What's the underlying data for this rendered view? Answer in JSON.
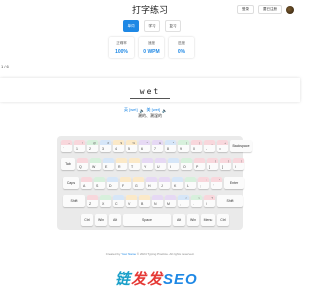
{
  "header": {
    "title": "打字练习",
    "login_label": "登录",
    "register_label": "要已注册"
  },
  "modes": [
    "单词",
    "学习",
    "复习"
  ],
  "stats": [
    {
      "label": "正确率",
      "value": "100%"
    },
    {
      "label": "速度",
      "value": "0 WPM"
    },
    {
      "label": "进度",
      "value": "0%"
    }
  ],
  "progress": "1 / 6",
  "word": "wet",
  "phonetics": {
    "uk": "英 [wet]",
    "us": "美 [wet]",
    "speaker": "🔈"
  },
  "meaning": "潮的、潮湿的",
  "finger_colors": {
    "pinky": "#f8d7dc",
    "ring": "#d7f0dc",
    "middle": "#d6e6f8",
    "index_left": "#fbe9c8",
    "index_right": "#e6d9f4",
    "thumb": "#ffffff"
  },
  "keyboard": {
    "rows": [
      [
        {
          "main": "`",
          "sym": "~"
        },
        {
          "main": "1",
          "sym": "!"
        },
        {
          "main": "2",
          "sym": "@"
        },
        {
          "main": "3",
          "sym": "#"
        },
        {
          "main": "4",
          "sym": "$"
        },
        {
          "main": "5",
          "sym": "%"
        },
        {
          "main": "6",
          "sym": "^"
        },
        {
          "main": "7",
          "sym": "&"
        },
        {
          "main": "8",
          "sym": "*"
        },
        {
          "main": "9",
          "sym": "("
        },
        {
          "main": "0",
          "sym": ")"
        },
        {
          "main": "-",
          "sym": "_"
        },
        {
          "main": "=",
          "sym": "+"
        },
        {
          "main": "Backspace",
          "sym": ""
        }
      ],
      [
        {
          "main": "Tab",
          "sym": ""
        },
        {
          "main": "Q",
          "sym": ""
        },
        {
          "main": "W",
          "sym": ""
        },
        {
          "main": "E",
          "sym": ""
        },
        {
          "main": "R",
          "sym": ""
        },
        {
          "main": "T",
          "sym": ""
        },
        {
          "main": "Y",
          "sym": ""
        },
        {
          "main": "U",
          "sym": ""
        },
        {
          "main": "I",
          "sym": ""
        },
        {
          "main": "O",
          "sym": ""
        },
        {
          "main": "P",
          "sym": ""
        },
        {
          "main": "[",
          "sym": "{"
        },
        {
          "main": "]",
          "sym": "}"
        },
        {
          "main": "\\",
          "sym": "|"
        }
      ],
      [
        {
          "main": "Caps",
          "sym": ""
        },
        {
          "main": "A",
          "sym": ""
        },
        {
          "main": "S",
          "sym": ""
        },
        {
          "main": "D",
          "sym": ""
        },
        {
          "main": "F",
          "sym": ""
        },
        {
          "main": "G",
          "sym": ""
        },
        {
          "main": "H",
          "sym": ""
        },
        {
          "main": "J",
          "sym": ""
        },
        {
          "main": "K",
          "sym": ""
        },
        {
          "main": "L",
          "sym": ""
        },
        {
          "main": ";",
          "sym": ":"
        },
        {
          "main": "'",
          "sym": "\""
        },
        {
          "main": "Enter",
          "sym": ""
        }
      ],
      [
        {
          "main": "Shift",
          "sym": ""
        },
        {
          "main": "Z",
          "sym": ""
        },
        {
          "main": "X",
          "sym": ""
        },
        {
          "main": "C",
          "sym": ""
        },
        {
          "main": "V",
          "sym": ""
        },
        {
          "main": "B",
          "sym": ""
        },
        {
          "main": "N",
          "sym": ""
        },
        {
          "main": "M",
          "sym": ""
        },
        {
          "main": ",",
          "sym": "<"
        },
        {
          "main": ".",
          "sym": ">"
        },
        {
          "main": "/",
          "sym": "?"
        },
        {
          "main": "Shift",
          "sym": ""
        }
      ],
      [
        {
          "main": "Ctrl",
          "sym": ""
        },
        {
          "main": "Win",
          "sym": ""
        },
        {
          "main": "Alt",
          "sym": ""
        },
        {
          "main": "Space",
          "sym": ""
        },
        {
          "main": "Alt",
          "sym": ""
        },
        {
          "main": "Win",
          "sym": ""
        },
        {
          "main": "Menu",
          "sym": ""
        },
        {
          "main": "Ctrl",
          "sym": ""
        }
      ]
    ]
  },
  "footer": {
    "prefix": "Created by ",
    "author": "Your Name",
    "suffix": " © 2024 Typing Practice. All rights reserved."
  },
  "watermark": {
    "part1": "链",
    "part2": "发发",
    "part3": "SEO"
  }
}
